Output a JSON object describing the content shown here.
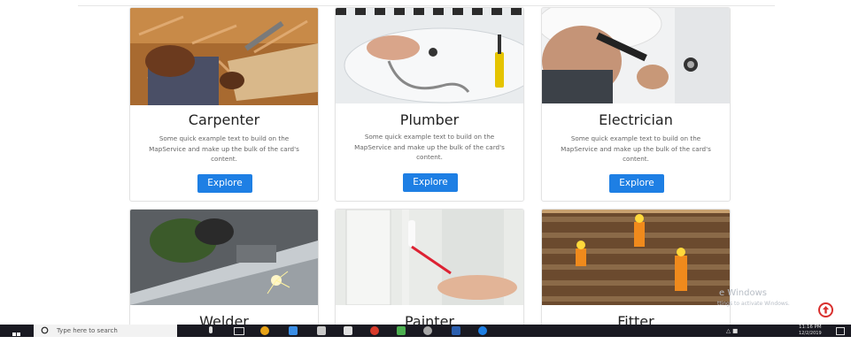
{
  "cards": [
    {
      "title": "Carpenter",
      "text": "Some quick example text to build on the MapService and make up the bulk of the card's content.",
      "button": "Explore"
    },
    {
      "title": "Plumber",
      "text": "Some quick example text to build on the MapService and make up the bulk of the card's content.",
      "button": "Explore"
    },
    {
      "title": "Electrician",
      "text": "Some quick example text to build on the MapService and make up the bulk of the card's content.",
      "button": "Explore"
    },
    {
      "title": "Welder"
    },
    {
      "title": "Painter"
    },
    {
      "title": "Fitter"
    }
  ],
  "overlay": {
    "activation_title": "e Windows",
    "activation_hint": "ttings to activate Windows."
  },
  "taskbar": {
    "search_placeholder": "Type here to search",
    "clock_time": "11:16 PM",
    "clock_date": "12/2/2019"
  },
  "colors": {
    "accent": "#1e7fe4",
    "scroll_top": "#d9302e",
    "taskbar": "#1a1a22"
  }
}
